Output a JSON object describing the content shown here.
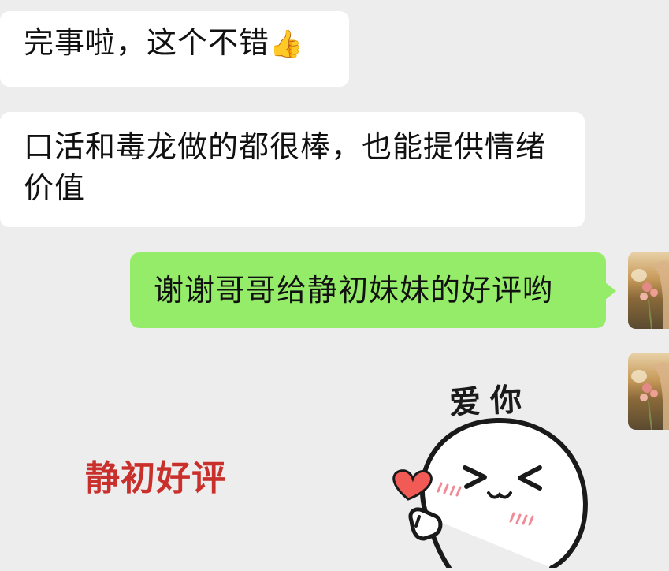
{
  "messages": [
    {
      "side": "left",
      "text": "完事啦，这个不错",
      "emoji": "👍"
    },
    {
      "side": "left",
      "text": "口活和毒龙做的都很棒，也能提供情绪价值"
    },
    {
      "side": "right",
      "text": "谢谢哥哥给静初妹妹的好评哟"
    }
  ],
  "sticker": {
    "caption": "爱你"
  },
  "watermark": "静初好评",
  "colors": {
    "background": "#ededed",
    "incoming_bubble": "#ffffff",
    "outgoing_bubble": "#95ec69",
    "watermark": "#c9302c"
  }
}
